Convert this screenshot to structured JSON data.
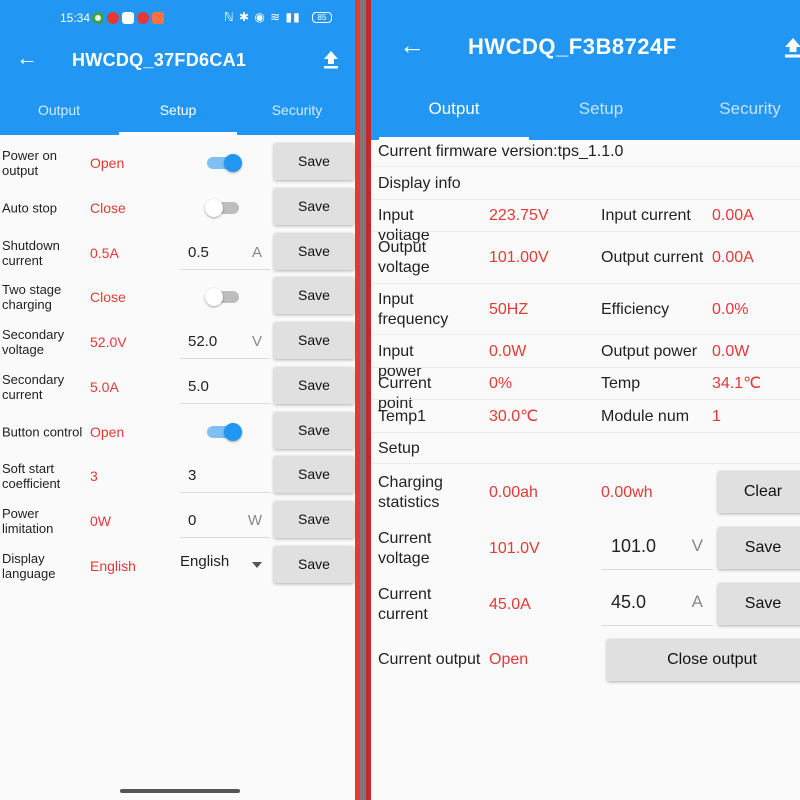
{
  "left": {
    "status": {
      "time": "15:34",
      "battery": "85"
    },
    "title": "HWCDQ_37FD6CA1",
    "tabs": [
      "Output",
      "Setup",
      "Security"
    ],
    "active_tab": "Setup",
    "rows": [
      {
        "label": "Power on output",
        "value": "Open",
        "control": "toggle",
        "on": true,
        "button": "Save"
      },
      {
        "label": "Auto stop",
        "value": "Close",
        "control": "toggle",
        "on": false,
        "button": "Save"
      },
      {
        "label": "Shutdown current",
        "value": "0.5A",
        "control": "input",
        "input": "0.5",
        "unit": "A",
        "button": "Save"
      },
      {
        "label": "Two stage charging",
        "value": "Close",
        "control": "toggle",
        "on": false,
        "button": "Save"
      },
      {
        "label": "Secondary voltage",
        "value": "52.0V",
        "control": "input",
        "input": "52.0",
        "unit": "V",
        "button": "Save"
      },
      {
        "label": "Secondary current",
        "value": "5.0A",
        "control": "input",
        "input": "5.0",
        "unit": "",
        "button": "Save"
      },
      {
        "label": "Button control",
        "value": "Open",
        "control": "toggle",
        "on": true,
        "button": "Save"
      },
      {
        "label": "Soft start coefficient",
        "value": "3",
        "control": "input",
        "input": "3",
        "unit": "",
        "button": "Save"
      },
      {
        "label": "Power limitation",
        "value": "0W",
        "control": "input",
        "input": "0",
        "unit": "W",
        "button": "Save"
      },
      {
        "label": "Display language",
        "value": "English",
        "control": "select",
        "input": "English",
        "button": "Save"
      }
    ]
  },
  "right": {
    "title": "HWCDQ_F3B8724F",
    "tabs": [
      "Output",
      "Setup",
      "Security"
    ],
    "active_tab": "Output",
    "firmware": "Current firmware version:tps_1.1.0",
    "display_info": "Display info",
    "info": [
      {
        "l1": "Input voltage",
        "v1": "223.75V",
        "l2": "Input current",
        "v2": "0.00A"
      },
      {
        "l1": "Output voltage",
        "v1": "101.00V",
        "l2": "Output current",
        "v2": "0.00A"
      },
      {
        "l1": "Input frequency",
        "v1": "50HZ",
        "l2": "Efficiency",
        "v2": "0.0%"
      },
      {
        "l1": "Input power",
        "v1": "0.0W",
        "l2": "Output power",
        "v2": "0.0W"
      },
      {
        "l1": "Current point",
        "v1": "0%",
        "l2": "Temp",
        "v2": "34.1℃"
      },
      {
        "l1": "Temp1",
        "v1": "30.0℃",
        "l2": "Module num",
        "v2": "1"
      }
    ],
    "setup_heading": "Setup",
    "charging": {
      "label": "Charging statistics",
      "ah": "0.00ah",
      "wh": "0.00wh",
      "button": "Clear"
    },
    "cur_voltage": {
      "label": "Current voltage",
      "value": "101.0V",
      "input": "101.0",
      "unit": "V",
      "button": "Save"
    },
    "cur_current": {
      "label": "Current current",
      "value": "45.0A",
      "input": "45.0",
      "unit": "A",
      "button": "Save"
    },
    "cur_output": {
      "label": "Current output",
      "value": "Open",
      "button": "Close output"
    }
  },
  "colors": {
    "primary": "#2196f3",
    "accent_red": "#e53935",
    "divider_red": "#e53935",
    "button_gray": "#e0e0e0"
  }
}
